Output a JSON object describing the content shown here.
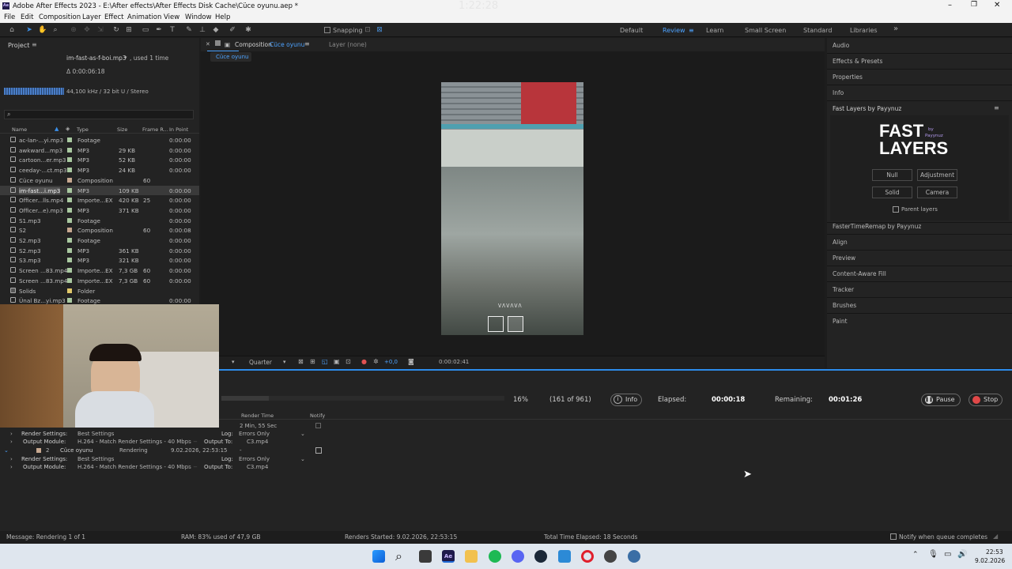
{
  "window": {
    "title": "Adobe After Effects 2023 - E:\\After effects\\After Effects Disk Cache\\Cüce oyunu.aep *",
    "ghost_clock": "1:22:28"
  },
  "menu": [
    "File",
    "Edit",
    "Composition",
    "Layer",
    "Effect",
    "Animation",
    "View",
    "Window",
    "Help"
  ],
  "toolbar": {
    "snapping": "Snapping",
    "workspaces": [
      "Default",
      "Review",
      "Learn",
      "Small Screen",
      "Standard",
      "Libraries"
    ],
    "active_workspace": "Review",
    "more": "»"
  },
  "project": {
    "title": "Project",
    "selected_file": "im-fast-as-f-boi.mp3",
    "used": ", used 1 time",
    "duration": "Δ 0:00:06:18",
    "audio_info": "44,100 kHz / 32 bit U / Stereo",
    "columns": [
      "Name",
      "Type",
      "Size",
      "Frame R...",
      "In Point"
    ],
    "items": [
      {
        "name": "ac-lan-...yi.mp3",
        "type": "Footage",
        "size": "",
        "fr": "",
        "in": "0:00:00",
        "color": "#a9c9a0"
      },
      {
        "name": "awkward...mp3",
        "type": "MP3",
        "size": "29 KB",
        "fr": "",
        "in": "0:00:00",
        "color": "#a9c9a0"
      },
      {
        "name": "cartoon...er.mp3",
        "type": "MP3",
        "size": "52 KB",
        "fr": "",
        "in": "0:00:00",
        "color": "#a9c9a0"
      },
      {
        "name": "ceeday-...ct.mp3",
        "type": "MP3",
        "size": "24 KB",
        "fr": "",
        "in": "0:00:00",
        "color": "#a9c9a0"
      },
      {
        "name": "Cüce oyunu",
        "type": "Composition",
        "size": "",
        "fr": "60",
        "in": "",
        "color": "#c7a890"
      },
      {
        "name": "im-fast...i.mp3",
        "type": "MP3",
        "size": "109 KB",
        "fr": "",
        "in": "0:00:00",
        "color": "#a9c9a0"
      },
      {
        "name": "Officer...lls.mp4",
        "type": "Importe...EX",
        "size": "420 KB",
        "fr": "25",
        "in": "0:00:00",
        "color": "#a9c9a0"
      },
      {
        "name": "Officer...e).mp3",
        "type": "MP3",
        "size": "371 KB",
        "fr": "",
        "in": "0:00:00",
        "color": "#a9c9a0"
      },
      {
        "name": "S1.mp3",
        "type": "Footage",
        "size": "",
        "fr": "",
        "in": "0:00:00",
        "color": "#a9c9a0"
      },
      {
        "name": "S2",
        "type": "Composition",
        "size": "",
        "fr": "60",
        "in": "0:00:08",
        "color": "#c7a890"
      },
      {
        "name": "S2.mp3",
        "type": "Footage",
        "size": "",
        "fr": "",
        "in": "0:00:00",
        "color": "#a9c9a0"
      },
      {
        "name": "S2.mp3",
        "type": "MP3",
        "size": "361 KB",
        "fr": "",
        "in": "0:00:00",
        "color": "#a9c9a0"
      },
      {
        "name": "S3.mp3",
        "type": "MP3",
        "size": "321 KB",
        "fr": "",
        "in": "0:00:00",
        "color": "#a9c9a0"
      },
      {
        "name": "Screen ...83.mp4",
        "type": "Importe...EX",
        "size": "7,3 GB",
        "fr": "60",
        "in": "0:00:00",
        "color": "#a9c9a0"
      },
      {
        "name": "Screen ...83.mp4",
        "type": "Importe...EX",
        "size": "7,3 GB",
        "fr": "60",
        "in": "0:00:00",
        "color": "#a9c9a0"
      },
      {
        "name": "Solids",
        "type": "Folder",
        "size": "",
        "fr": "",
        "in": "",
        "color": "#e1c86a"
      },
      {
        "name": "Ünal Bz...yi.mp3",
        "type": "Footage",
        "size": "",
        "fr": "",
        "in": "0:00:00",
        "color": "#a9c9a0"
      }
    ]
  },
  "composition": {
    "tab": "Composition",
    "comp_name": "Cüce oyunu",
    "layer_tab": "Layer (none)",
    "breadcrumb": "Cüce oyunu",
    "resolution": "Quarter",
    "exposure": "+0,0",
    "timecode": "0:00:02:41",
    "frame_caption": "ᐯᐱᐯᐱᐯᐱ"
  },
  "right_panels": {
    "top": [
      "Audio",
      "Effects & Presets",
      "Properties",
      "Info"
    ],
    "fast_layers_title": "Fast Layers by Payynuz",
    "logo_line1": "FAST",
    "logo_line2": "LAYERS",
    "logo_by": "by",
    "logo_author": "Payynuz",
    "buttons": [
      "Null",
      "Adjustment",
      "Solid",
      "Camera"
    ],
    "parent_layers": "Parent layers",
    "bottom": [
      "FasterTimeRemap by Payynuz",
      "Align",
      "Preview",
      "Content-Aware Fill",
      "Tracker",
      "Brushes",
      "Paint"
    ]
  },
  "render_queue": {
    "progress": {
      "percent_text": "16%",
      "frames": "(161 of 961)",
      "fraction": 0.1675
    },
    "info_btn": "Info",
    "elapsed_label": "Elapsed:",
    "elapsed": "00:00:18",
    "remaining_label": "Remaining:",
    "remaining": "00:01:26",
    "pause": "Pause",
    "stop": "Stop",
    "col_render_time": "Render Time",
    "col_notify": "Notify",
    "item1_time": "2 Min, 55 Sec",
    "render_settings_label": "Render Settings:",
    "render_settings_value": "Best Settings",
    "log_label": "Log:",
    "log_value": "Errors Only",
    "output_module_label": "Output Module:",
    "output_module_value": "H.264 - Match Render Settings - 40 Mbps",
    "output_to_label": "Output To:",
    "output_to_value": "C3.mp4",
    "item2_index": "2",
    "item2_name": "Cüce oyunu",
    "item2_status": "Rendering",
    "item2_started": "9.02.2026, 22:53:15",
    "item2_time": "-"
  },
  "status_bar": {
    "message": "Message:  Rendering 1 of 1",
    "ram": "RAM:  83% used of 47,9 GB",
    "renders_started": "Renders Started:  9.02.2026, 22:53:15",
    "total_elapsed": "Total Time Elapsed:  18 Seconds",
    "notify_label": "Notify when queue completes"
  },
  "taskbar": {
    "time": "22:53",
    "date": "9.02.2026",
    "colors": {
      "start": "#1e90ff",
      "ae": "#1f1a4b",
      "spotify": "#1db954",
      "discord": "#5865f2",
      "opera": "#e01f2c",
      "steam": "#1b2838"
    }
  }
}
